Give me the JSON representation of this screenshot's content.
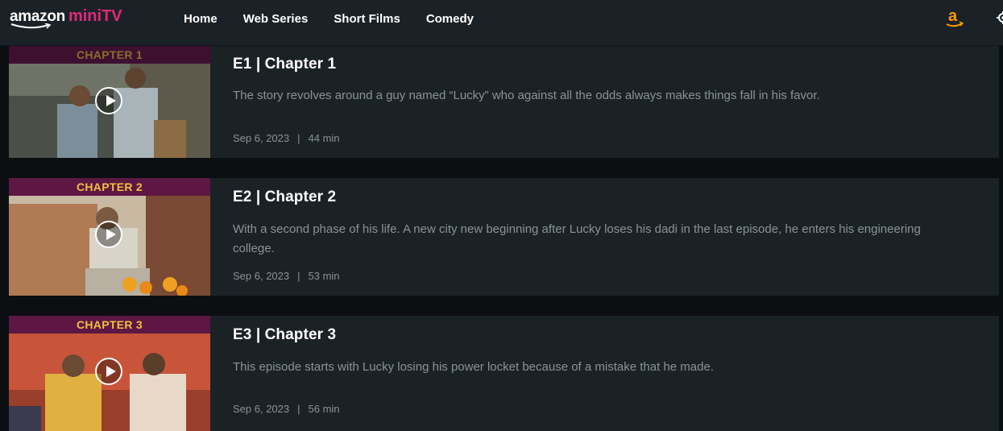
{
  "header": {
    "logo_word": "amazon",
    "logo_brand": "miniTV",
    "nav": [
      "Home",
      "Web Series",
      "Short Films",
      "Comedy"
    ]
  },
  "episodes": [
    {
      "banner": "CHAPTER 1",
      "title": "E1 | Chapter 1",
      "description": "The story revolves around a guy named “Lucky” who against all the odds always makes things fall in his favor.",
      "date": "Sep 6, 2023",
      "duration": "44 min"
    },
    {
      "banner": "CHAPTER 2",
      "title": "E2 | Chapter 2",
      "description": "With a second phase of his life. A new city new beginning after Lucky loses his dadi in the last episode, he enters his engineering college.",
      "date": "Sep 6, 2023",
      "duration": "53 min"
    },
    {
      "banner": "CHAPTER 3",
      "title": "E3 | Chapter 3",
      "description": "This episode starts with Lucky losing his power locket because of a mistake that he made.",
      "date": "Sep 6, 2023",
      "duration": "56 min"
    }
  ],
  "meta_separator": "|",
  "colors": {
    "brand_pink": "#e1287a",
    "amazon_orange": "#ff9900",
    "banner_gold": "#f0c040"
  },
  "icons": {
    "amazon": "amazon-a-icon",
    "settings": "gear-icon",
    "play": "play-icon"
  }
}
